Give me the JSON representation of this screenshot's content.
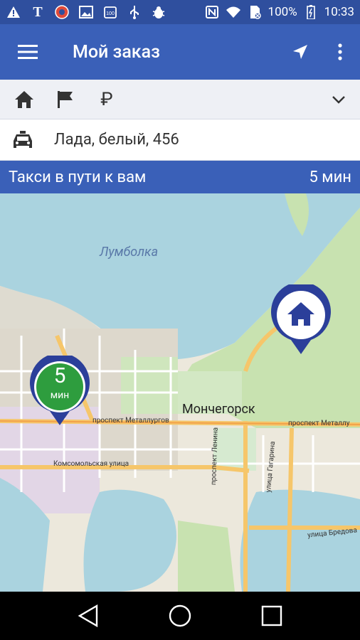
{
  "status_bar": {
    "battery": "100%",
    "time": "10:33",
    "icons_left": [
      "warning-icon",
      "t-icon",
      "app-icon",
      "image-icon",
      "hundred-icon",
      "usb-icon",
      "bug-icon"
    ],
    "icons_right": [
      "nfc-icon",
      "wifi-icon",
      "no-sim-icon",
      "battery-icon"
    ]
  },
  "app_bar": {
    "title": "Мой заказ",
    "icons": [
      "menu-icon",
      "navigation-arrow-icon",
      "more-vert-icon"
    ]
  },
  "icon_row": {
    "items": [
      "home-icon",
      "flag-icon",
      "ruble-icon"
    ],
    "ruble": "₽",
    "chevron": "chevron-down-icon"
  },
  "car": {
    "description": "Лада, белый, 456"
  },
  "eta": {
    "message": "Такси в пути к вам",
    "time": "5 мин"
  },
  "map": {
    "labels": {
      "lake": "Лумболка",
      "city": "Мончегорск",
      "street_1": "проспект Металлургов",
      "street_2": "проспект Металлу",
      "street_3": "Комсомольская улица",
      "street_4": "проспект Ленина",
      "street_5": "улица Гагарина",
      "street_6": "улица Бредова"
    },
    "eta_pin": {
      "number": "5",
      "unit": "мин",
      "color": "#2e9d3e"
    },
    "home_pin": {
      "color": "#2f3f9a"
    }
  },
  "colors": {
    "primary": "#3a60b8",
    "status_bar": "#2f4f9e",
    "water": "#aad3df",
    "park": "#c8e6b4",
    "road": "#f6c66a"
  }
}
